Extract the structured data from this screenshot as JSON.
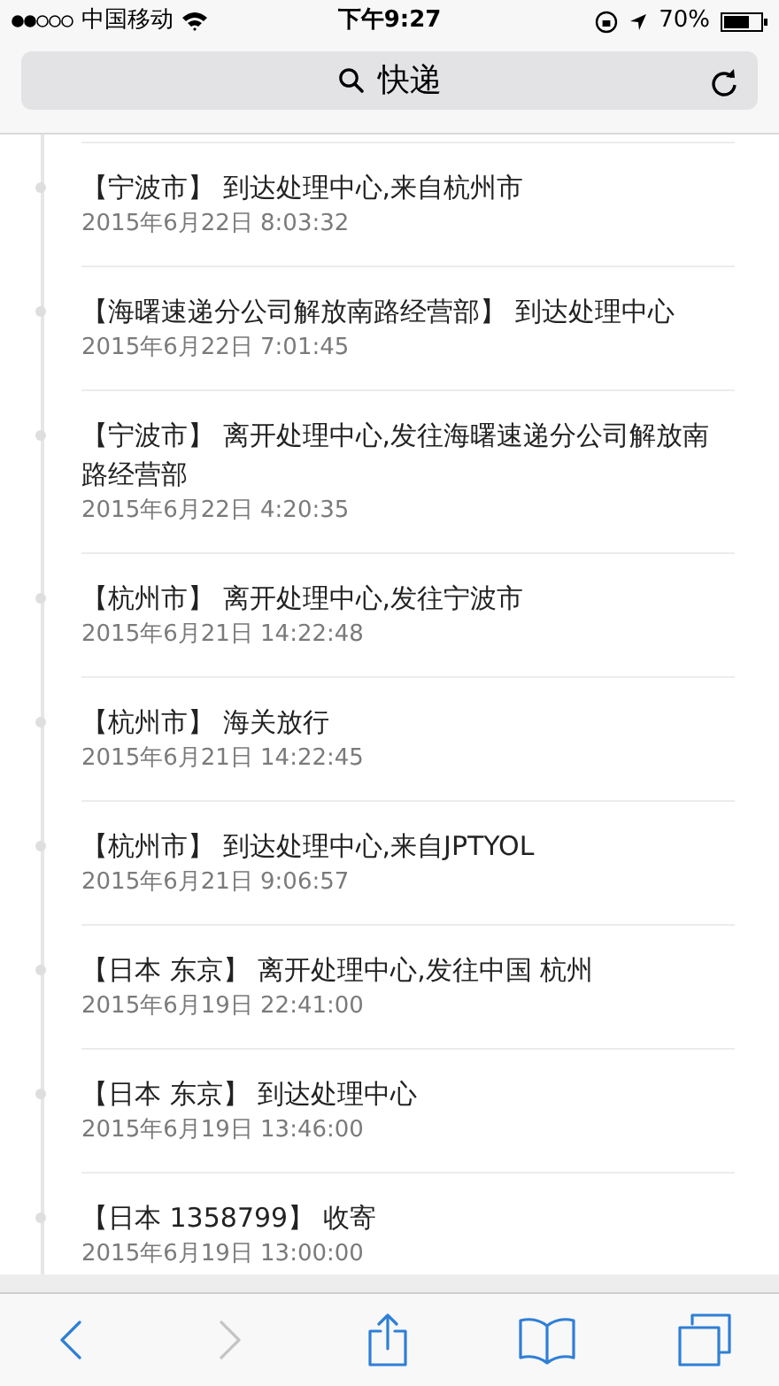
{
  "status_bar": {
    "carrier": "中国移动",
    "time": "下午9:27",
    "battery": "70%"
  },
  "address_bar": {
    "text": "快递"
  },
  "events": [
    {
      "location": "【宁波市】",
      "description": "到达处理中心,来自杭州市",
      "time": "2015年6月22日 8:03:32"
    },
    {
      "location": "【海曙速递分公司解放南路经营部】",
      "description": "到达处理中心",
      "time": "2015年6月22日 7:01:45"
    },
    {
      "location": "【宁波市】",
      "description": "离开处理中心,发往海曙速递分公司解放南路经营部",
      "time": "2015年6月22日 4:20:35"
    },
    {
      "location": "【杭州市】",
      "description": "离开处理中心,发往宁波市",
      "time": "2015年6月21日 14:22:48"
    },
    {
      "location": "【杭州市】",
      "description": "海关放行",
      "time": "2015年6月21日 14:22:45"
    },
    {
      "location": "【杭州市】",
      "description": "到达处理中心,来自JPTYOL",
      "time": "2015年6月21日 9:06:57"
    },
    {
      "location": "【日本 东京】",
      "description": "离开处理中心,发往中国 杭州",
      "time": "2015年6月19日 22:41:00"
    },
    {
      "location": "【日本 东京】",
      "description": "到达处理中心",
      "time": "2015年6月19日 13:46:00"
    },
    {
      "location": "【日本 1358799】",
      "description": "收寄",
      "time": "2015年6月19日 13:00:00"
    }
  ],
  "toolbar": [
    {
      "kind": "back",
      "disabled": false
    },
    {
      "kind": "forward",
      "disabled": true
    },
    {
      "kind": "share",
      "disabled": false
    },
    {
      "kind": "bookmarks",
      "disabled": false
    },
    {
      "kind": "tabs",
      "disabled": false
    }
  ]
}
